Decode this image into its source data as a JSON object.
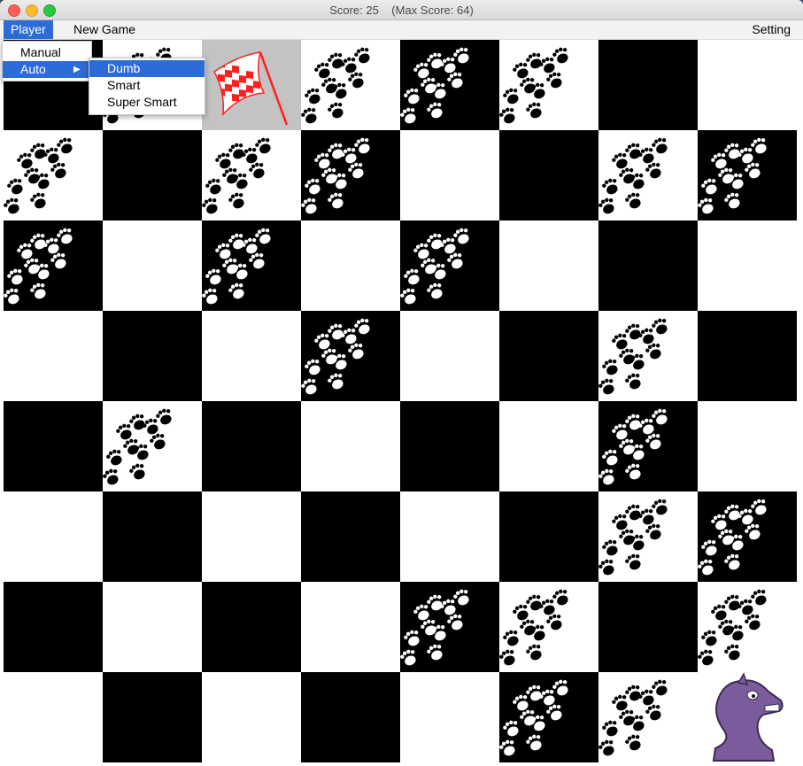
{
  "window": {
    "title": "Score: 25    (Max Score: 64)"
  },
  "menubar": {
    "player": "Player",
    "new_game": "New Game",
    "setting": "Setting"
  },
  "player_menu": {
    "items": [
      "Manual",
      "Auto"
    ],
    "highlighted": "Auto"
  },
  "auto_submenu": {
    "items": [
      "Dumb",
      "Smart",
      "Super Smart"
    ],
    "highlighted": "Dumb"
  },
  "board": {
    "rows": 8,
    "cols": 8,
    "cells": [
      [
        "b",
        "w",
        "g",
        "w",
        "b",
        "w",
        "b",
        "w"
      ],
      [
        "w",
        "b",
        "w",
        "b",
        "w",
        "b",
        "w",
        "b"
      ],
      [
        "b",
        "w",
        "b",
        "w",
        "b",
        "w",
        "b",
        "w"
      ],
      [
        "w",
        "b",
        "w",
        "b",
        "w",
        "b",
        "w",
        "b"
      ],
      [
        "b",
        "w",
        "b",
        "w",
        "b",
        "w",
        "b",
        "w"
      ],
      [
        "w",
        "b",
        "w",
        "b",
        "w",
        "b",
        "w",
        "b"
      ],
      [
        "b",
        "w",
        "b",
        "w",
        "b",
        "w",
        "b",
        "w"
      ],
      [
        "w",
        "b",
        "w",
        "b",
        "w",
        "b",
        "w",
        "w"
      ]
    ],
    "paw_cells": [
      [
        0,
        1
      ],
      [
        0,
        3
      ],
      [
        0,
        4
      ],
      [
        0,
        5
      ],
      [
        1,
        0
      ],
      [
        1,
        2
      ],
      [
        1,
        3
      ],
      [
        1,
        6
      ],
      [
        1,
        7
      ],
      [
        2,
        0
      ],
      [
        2,
        2
      ],
      [
        2,
        4
      ],
      [
        3,
        3
      ],
      [
        3,
        6
      ],
      [
        4,
        1
      ],
      [
        4,
        6
      ],
      [
        5,
        6
      ],
      [
        5,
        7
      ],
      [
        6,
        4
      ],
      [
        6,
        5
      ],
      [
        6,
        7
      ],
      [
        7,
        5
      ],
      [
        7,
        6
      ]
    ],
    "flag_cell": [
      0,
      2
    ],
    "knight_cell": [
      7,
      7
    ]
  },
  "colors": {
    "accent": "#2d6bd6",
    "flag": "#ff1f1f",
    "knight": "#7a5b9c"
  }
}
